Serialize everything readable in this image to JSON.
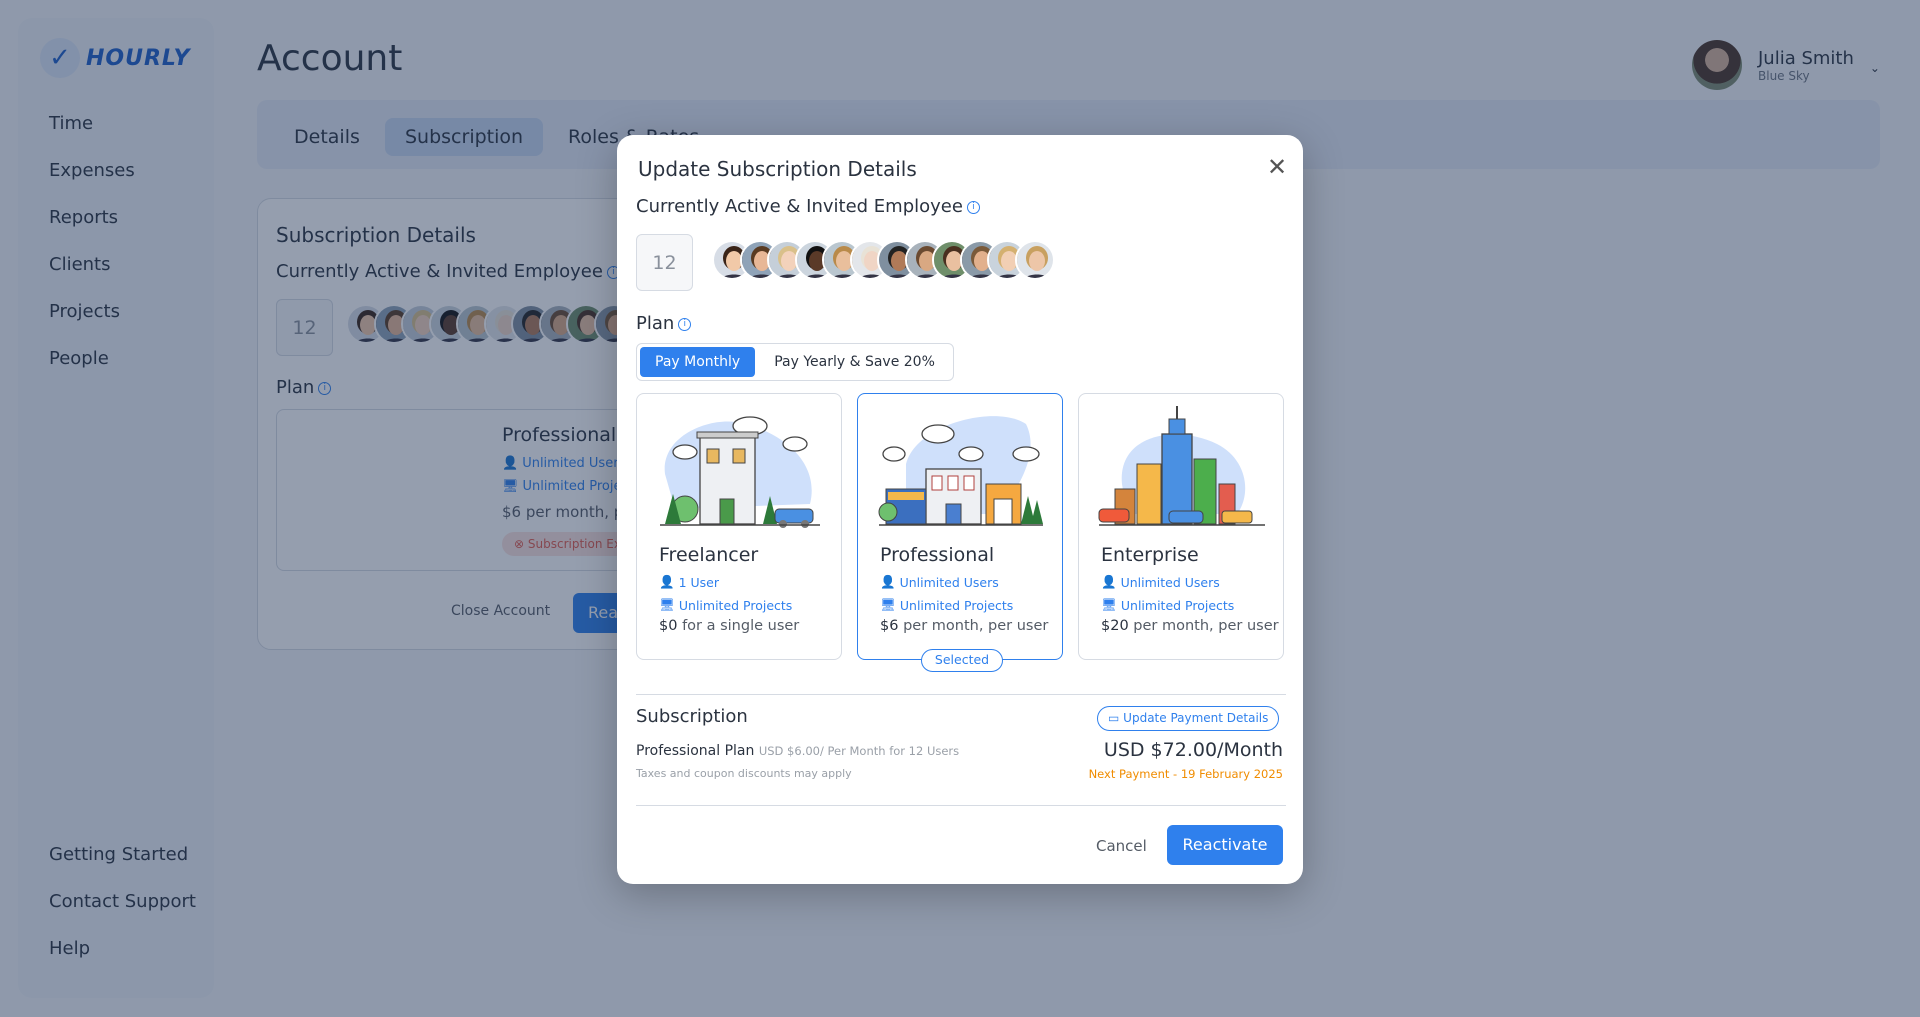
{
  "app": {
    "logo": "HOURLY",
    "page_title": "Account"
  },
  "sidebar": {
    "items": [
      {
        "label": "Time"
      },
      {
        "label": "Expenses"
      },
      {
        "label": "Reports"
      },
      {
        "label": "Clients"
      },
      {
        "label": "Projects"
      },
      {
        "label": "People"
      }
    ],
    "bottom": [
      {
        "label": "Getting Started"
      },
      {
        "label": "Contact Support"
      },
      {
        "label": "Help"
      }
    ]
  },
  "user": {
    "name": "Julia Smith",
    "company": "Blue Sky"
  },
  "tabs": [
    {
      "label": "Details"
    },
    {
      "label": "Subscription",
      "active": true
    },
    {
      "label": "Roles & Rates"
    }
  ],
  "background_card": {
    "title": "Subscription Details",
    "employees_label": "Currently Active & Invited Employee",
    "count": "12",
    "plan_label": "Plan",
    "plan_name": "Professional",
    "feature_users": "Unlimited Users",
    "feature_projects": "Unlimited Projects",
    "price_amount": "$6",
    "price_text": "per month, per user",
    "status": "Subscription Expired",
    "close_account": "Close Account",
    "reactivate": "Reactivate"
  },
  "modal": {
    "title": "Update Subscription Details",
    "employees_label": "Currently Active & Invited Employee",
    "employee_count": "12",
    "plan_label": "Plan",
    "billing": {
      "monthly": "Pay Monthly",
      "yearly": "Pay Yearly & Save 20%",
      "selected": "monthly"
    },
    "plans": [
      {
        "name": "Freelancer",
        "users": "1 User",
        "projects": "Unlimited Projects",
        "price": "$0",
        "price_text": "for a single user",
        "selected": false
      },
      {
        "name": "Professional",
        "users": "Unlimited Users",
        "projects": "Unlimited Projects",
        "price": "$6",
        "price_text": "per month, per user",
        "selected": true
      },
      {
        "name": "Enterprise",
        "users": "Unlimited Users",
        "projects": "Unlimited Projects",
        "price": "$20",
        "price_text": "per month, per user",
        "selected": false
      }
    ],
    "selected_badge": "Selected",
    "subscription": {
      "title": "Subscription",
      "update_payment": "Update Payment Details",
      "plan_name": "Professional Plan",
      "plan_detail": "USD $6.00/ Per Month for 12 Users",
      "note": "Taxes and coupon discounts may apply",
      "total": "USD $72.00/Month",
      "next_payment": "Next Payment - 19 February 2025"
    },
    "cancel": "Cancel",
    "reactivate": "Reactivate"
  },
  "colors": {
    "accent": "#2f80ed",
    "warning": "#f08c00",
    "danger": "#e35d4f"
  }
}
